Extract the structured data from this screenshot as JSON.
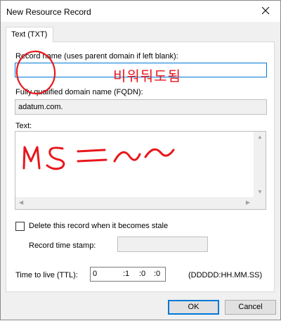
{
  "window": {
    "title": "New Resource Record"
  },
  "tabs": [
    {
      "label": "Text (TXT)"
    }
  ],
  "record_name": {
    "label": "Record name (uses parent domain if left blank):",
    "value": ""
  },
  "fqdn": {
    "label": "Fully qualified domain name (FQDN):",
    "value": "adatum.com."
  },
  "text": {
    "label": "Text:",
    "value": ""
  },
  "delete_stale": {
    "label": "Delete this record when it becomes stale",
    "checked": false
  },
  "timestamp": {
    "label": "Record time stamp:",
    "value": ""
  },
  "ttl": {
    "label": "Time to live (TTL):",
    "days": "0",
    "hours": ":1",
    "minutes": ":0",
    "seconds": ":0",
    "format": "(DDDDD:HH.MM.SS)"
  },
  "buttons": {
    "ok": "OK",
    "cancel": "Cancel"
  },
  "annotation": {
    "text": "비워둬도됨",
    "color": "#e8171c"
  },
  "colors": {
    "accent": "#0078d7",
    "annotation": "#e8171c"
  }
}
